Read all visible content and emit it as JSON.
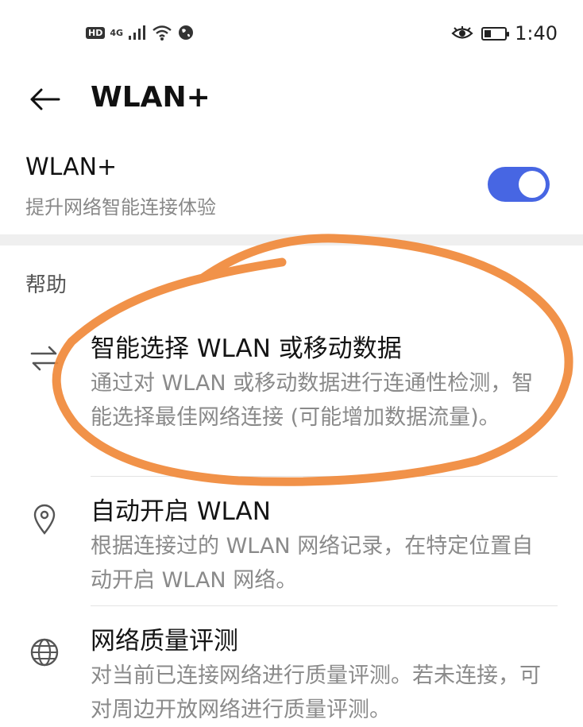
{
  "status_bar": {
    "hd_badge": "HD",
    "network_type": "4G",
    "time": "1:40",
    "icons": [
      "hd-icon",
      "signal-icon",
      "wifi-icon",
      "vpn-globe-icon",
      "eye-comfort-icon",
      "battery-icon"
    ],
    "battery_level": 0.35
  },
  "app_bar": {
    "back_icon": "arrow-left-icon",
    "title": "WLAN+"
  },
  "wlan_plus": {
    "title": "WLAN+",
    "subtitle": "提升网络智能连接体验",
    "enabled": true,
    "accent_color": "#4766e3"
  },
  "help": {
    "section_label": "帮助",
    "items": [
      {
        "icon": "switch-arrows-icon",
        "title": "智能选择 WLAN 或移动数据",
        "description": "通过对 WLAN 或移动数据进行连通性检测，智能选择最佳网络连接 (可能增加数据流量)。"
      },
      {
        "icon": "location-pin-icon",
        "title": "自动开启 WLAN",
        "description": "根据连接过的 WLAN 网络记录，在特定位置自动开启 WLAN 网络。"
      },
      {
        "icon": "globe-icon",
        "title": "网络质量评测",
        "description": "对当前已连接网络进行质量评测。若未连接，可对周边开放网络进行质量评测。"
      }
    ]
  },
  "annotation_color": "#f0893a"
}
